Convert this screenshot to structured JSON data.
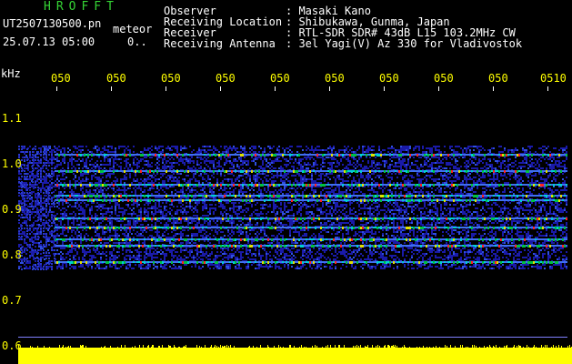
{
  "header": {
    "brand": "HROFFT",
    "filename": "UT2507130500.pn",
    "datetime": "25.07.13 05:00",
    "counter": "0..",
    "mode": "meteor",
    "labels": {
      "observer": "Observer",
      "location": "Receiving Location",
      "receiver": "Receiver",
      "antenna": "Receiving Antenna"
    },
    "values": {
      "observer": ": Masaki Kano",
      "location": ": Shibukawa, Gunma, Japan",
      "receiver": ": RTL-SDR SDR# 43dB L15 103.2MHz CW",
      "antenna": ": 3el Yagi(V) Az 330 for Vladivostok"
    }
  },
  "axis": {
    "unit": "kHz",
    "y_ticks": [
      "1.1",
      "1.0",
      "0.9",
      "0.8",
      "0.7",
      "0.6"
    ],
    "x_ticks": [
      "050",
      "050",
      "050",
      "050",
      "050",
      "050",
      "050",
      "050",
      "050",
      "0510"
    ]
  },
  "colors": {
    "background": "#000000",
    "text": "#ffffff",
    "accent": "#ffff00",
    "brand": "#35d435",
    "noise": "#1a1aa8",
    "signal_mid": "#00c040",
    "signal_high": "#ff2020"
  },
  "spectrogram": {
    "freq_range_khz": [
      0.6,
      1.15
    ],
    "lines_khz": [
      1.02,
      0.985,
      0.955,
      0.93,
      0.92,
      0.88,
      0.86,
      0.835,
      0.82,
      0.785
    ]
  }
}
